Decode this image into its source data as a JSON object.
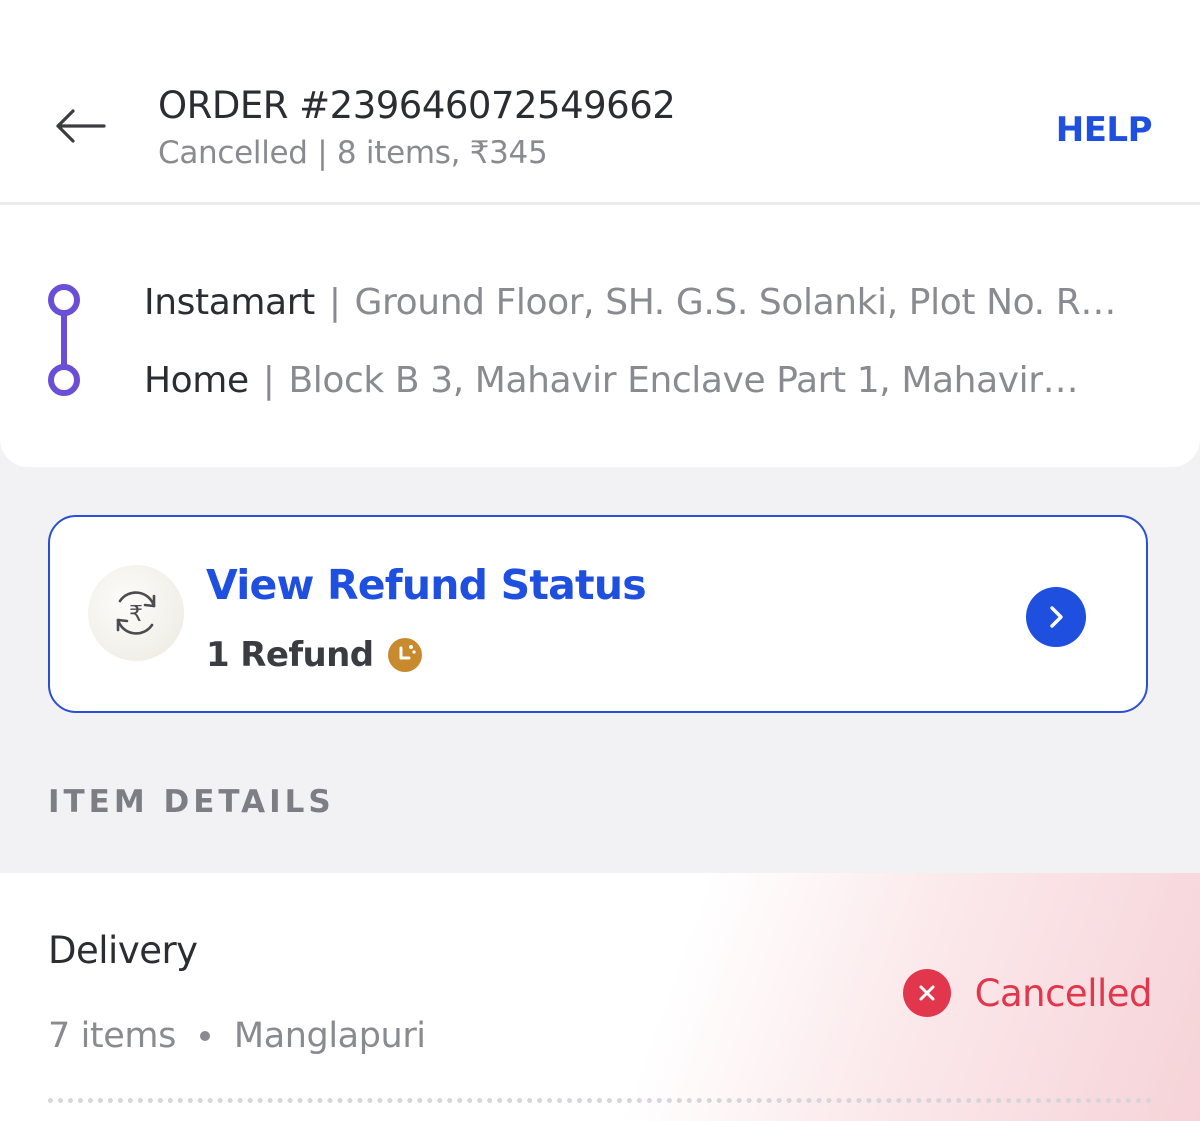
{
  "header": {
    "title": "ORDER #239646072549662",
    "subtitle": "Cancelled | 8 items, ₹345",
    "help_label": "HELP",
    "back_icon": "arrow-left-icon"
  },
  "addresses": {
    "route_icon": "route-icon",
    "route_color": "#6a4fd6",
    "separator": "|",
    "from": {
      "label": "Instamart",
      "address": "Ground Floor, SH. G.S. Solanki, Plot No. R…"
    },
    "to": {
      "label": "Home",
      "address": "Block B 3, Mahavir Enclave Part 1, Mahavir…"
    }
  },
  "refund": {
    "title": "View Refund Status",
    "count_text": "1 Refund",
    "icon": "rupee-refresh-icon",
    "status_icon": "pending-clock-icon",
    "arrow_icon": "chevron-right-icon",
    "accent": "#1f4fdf"
  },
  "item_details": {
    "heading": "ITEM DETAILS",
    "delivery": {
      "title": "Delivery",
      "item_count": "7 items",
      "location": "Manglapuri",
      "status": "Cancelled",
      "status_icon": "close-circle-icon",
      "status_color": "#e2364c"
    }
  }
}
